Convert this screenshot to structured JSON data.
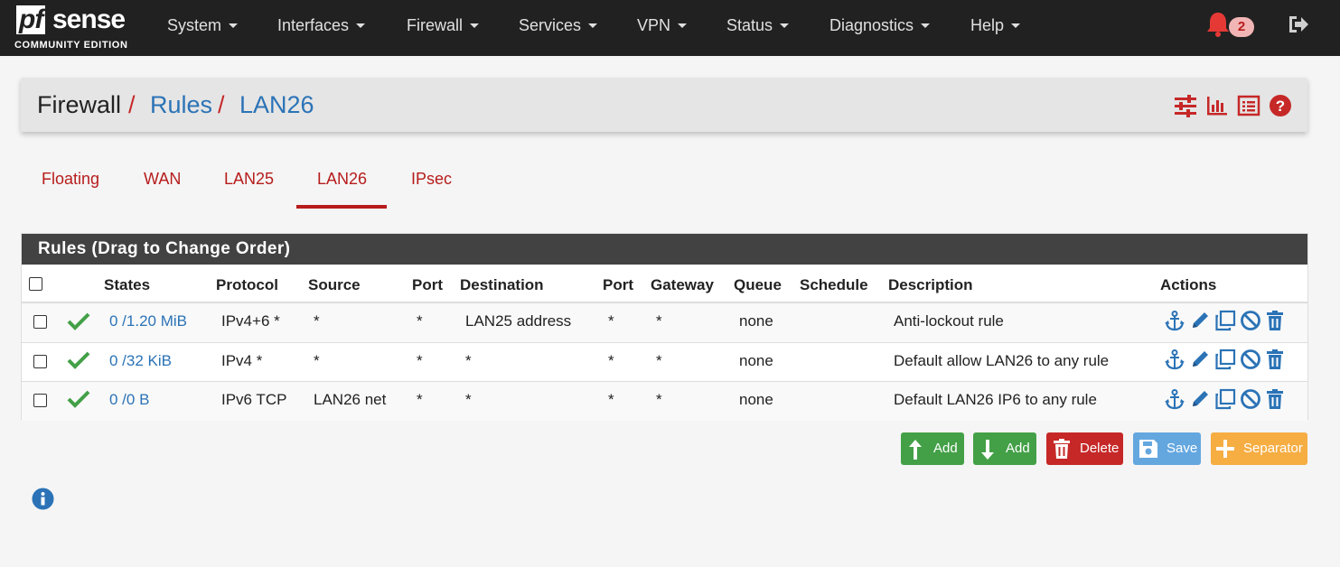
{
  "brand": {
    "logo_pf": "pf",
    "logo_sense": "sense",
    "edition": "COMMUNITY EDITION"
  },
  "nav": {
    "items": [
      {
        "label": "System"
      },
      {
        "label": "Interfaces"
      },
      {
        "label": "Firewall"
      },
      {
        "label": "Services"
      },
      {
        "label": "VPN"
      },
      {
        "label": "Status"
      },
      {
        "label": "Diagnostics"
      },
      {
        "label": "Help"
      }
    ],
    "notification_count": "2",
    "icons": [
      "bell-icon",
      "logout-icon"
    ]
  },
  "breadcrumb": {
    "root": "Firewall",
    "separator": "/",
    "level1": "Rules",
    "level2": "LAN26"
  },
  "header_icons": [
    "sliders-icon",
    "bar-chart-icon",
    "list-icon",
    "help-icon"
  ],
  "tabs": [
    {
      "label": "Floating"
    },
    {
      "label": "WAN"
    },
    {
      "label": "LAN25"
    },
    {
      "label": "LAN26",
      "active": true
    },
    {
      "label": "IPsec"
    }
  ],
  "rules_panel": {
    "title": "Rules (Drag to Change Order)",
    "columns": [
      "States",
      "Protocol",
      "Source",
      "Port",
      "Destination",
      "Port",
      "Gateway",
      "Queue",
      "Schedule",
      "Description",
      "Actions"
    ],
    "rows": [
      {
        "states": "0 /1.20 MiB",
        "protocol": "IPv4+6 *",
        "source": "*",
        "source_port": "*",
        "destination": "LAN25 address",
        "dest_port": "*",
        "gateway": "*",
        "queue": "none",
        "schedule": "",
        "description": "Anti-lockout rule"
      },
      {
        "states": "0 /32 KiB",
        "protocol": "IPv4 *",
        "source": "*",
        "source_port": "*",
        "destination": "*",
        "dest_port": "*",
        "gateway": "*",
        "queue": "none",
        "schedule": "",
        "description": "Default allow LAN26 to any rule"
      },
      {
        "states": "0 /0 B",
        "protocol": "IPv6 TCP",
        "source": "LAN26 net",
        "source_port": "*",
        "destination": "*",
        "dest_port": "*",
        "gateway": "*",
        "queue": "none",
        "schedule": "",
        "description": "Default LAN26 IP6 to any rule"
      }
    ],
    "row_action_icons": [
      "anchor-icon",
      "pencil-icon",
      "copy-icon",
      "disable-icon",
      "trash-icon"
    ]
  },
  "buttons": {
    "add_top": "Add",
    "add_bottom": "Add",
    "delete": "Delete",
    "save": "Save",
    "separator": "Separator"
  },
  "colors": {
    "navbar": "#212121",
    "accent_red": "#b71c1c",
    "link_blue": "#2b73b6",
    "success_green": "#43a047",
    "danger_red": "#c62828",
    "save_blue": "#64a7df",
    "warning_orange": "#f6ad42"
  }
}
